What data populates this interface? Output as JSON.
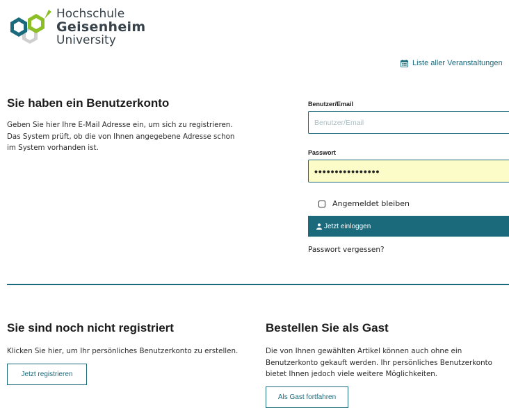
{
  "logo": {
    "line1": "Hochschule",
    "line2": "Geisenheim",
    "line3": "University"
  },
  "events_link": "Liste aller Veranstaltungen",
  "account": {
    "title": "Sie haben ein Benutzerkonto",
    "text_line1": "Geben Sie hier Ihre E-Mail Adresse ein, um sich zu registrieren.",
    "text_line2": "Das System prüft, ob die von Ihnen angegebene Adresse schon",
    "text_line3": "im System vorhanden ist."
  },
  "login": {
    "user_label": "Benutzer/Email",
    "user_placeholder": "Benutzer/Email",
    "user_value": "",
    "password_label": "Passwort",
    "password_value": "••••••••••••••••",
    "remember_label": "Angemeldet bleiben",
    "remember_checked": false,
    "submit_label": "Jetzt einloggen",
    "forgot_label": "Passwort vergessen?"
  },
  "register": {
    "title": "Sie sind noch nicht registriert",
    "text": "Klicken Sie hier, um Ihr persönliches Benutzerkonto zu erstellen.",
    "button": "Jetzt registrieren"
  },
  "guest": {
    "title": "Bestellen Sie als Gast",
    "text_line1": "Die von Ihnen gewählten Artikel können auch ohne ein",
    "text_line2": "Benutzerkonto gekauft werden. Ihr persönliches Benutzerkonto",
    "text_line3": "bietet Ihnen jedoch viele weitere Möglichkeiten.",
    "button": "Als Gast fortfahren"
  },
  "colors": {
    "accent": "#1a6a7c",
    "logo_green": "#8cbf26",
    "logo_gray": "#c4c4c4",
    "password_bg": "#fcfcc8"
  }
}
